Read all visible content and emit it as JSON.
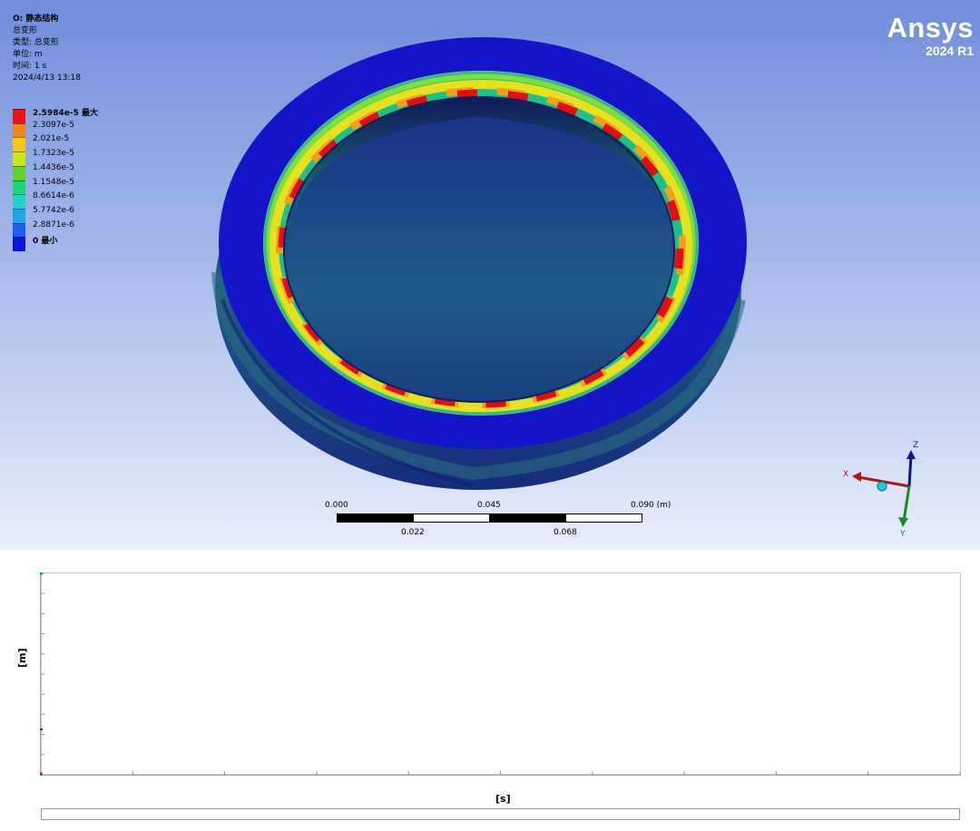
{
  "header": {
    "title": "O: 静态结构",
    "type_line": "总变形",
    "kind_line": "类型: 总变形",
    "unit_line": "单位: m",
    "time_line": "时间: 1 s",
    "date_line": "2024/4/13 13:18"
  },
  "legend": {
    "items": [
      {
        "label": "2.5984e-5 最大",
        "color": "#e8141a",
        "bold": true
      },
      {
        "label": "2.3097e-5",
        "color": "#f0841d",
        "bold": false
      },
      {
        "label": "2.021e-5",
        "color": "#f4c718",
        "bold": false
      },
      {
        "label": "1.7323e-5",
        "color": "#c8e81c",
        "bold": false
      },
      {
        "label": "1.4436e-5",
        "color": "#5fd42c",
        "bold": false
      },
      {
        "label": "1.1548e-5",
        "color": "#1fd47f",
        "bold": false
      },
      {
        "label": "8.6614e-6",
        "color": "#1ed4c7",
        "bold": false
      },
      {
        "label": "5.7742e-6",
        "color": "#1fa5e6",
        "bold": false
      },
      {
        "label": "2.8871e-6",
        "color": "#1b5ff0",
        "bold": false
      },
      {
        "label": "0 最小",
        "color": "#0b16d9",
        "bold": true
      }
    ]
  },
  "logo": {
    "brand": "Ansys",
    "version": "2024 R1"
  },
  "scalebar": {
    "top_labels": [
      "0.000",
      "0.045",
      "0.090 (m)"
    ],
    "bottom_labels": [
      "0.022",
      "0.068"
    ]
  },
  "triad": {
    "x": "X",
    "y": "Y",
    "z": "Z"
  },
  "graph": {
    "ylabel": "[m]",
    "xlabel": "[s]"
  },
  "colors": {
    "bearing_blue": "#1414c8",
    "hot_red": "#e01010",
    "viewport_top": "#6f8edc"
  }
}
